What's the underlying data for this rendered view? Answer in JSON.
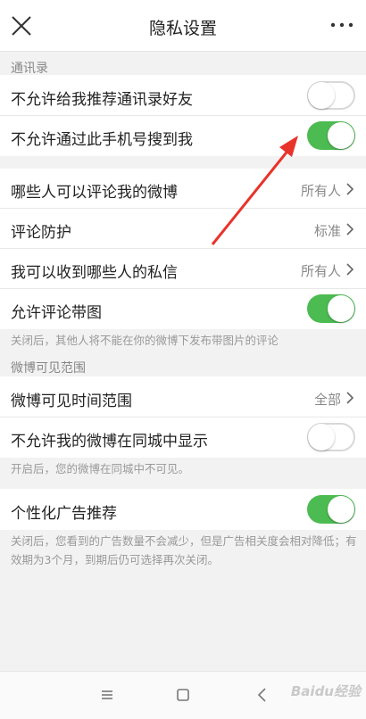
{
  "header": {
    "title": "隐私设置",
    "close_icon": "close-icon",
    "more_icon": "more-dots-icon"
  },
  "sections": {
    "contacts_title": "通讯录",
    "weibo_visible_title": "微博可见范围"
  },
  "rows": {
    "no_recommend_contacts": {
      "label": "不允许给我推荐通讯录好友",
      "toggle": "off"
    },
    "no_search_by_phone": {
      "label": "不允许通过此手机号搜到我",
      "toggle": "on"
    },
    "who_can_comment": {
      "label": "哪些人可以评论我的微博",
      "value": "所有人"
    },
    "comment_protection": {
      "label": "评论防护",
      "value": "标准"
    },
    "who_can_message": {
      "label": "我可以收到哪些人的私信",
      "value": "所有人"
    },
    "allow_comment_images": {
      "label": "允许评论带图",
      "toggle": "on"
    },
    "weibo_visible_time": {
      "label": "微博可见时间范围",
      "value": "全部"
    },
    "no_show_same_city": {
      "label": "不允许我的微博在同城中显示",
      "toggle": "off"
    },
    "personalized_ads": {
      "label": "个性化广告推荐",
      "toggle": "on"
    }
  },
  "notes": {
    "comment_images_note": "关闭后，其他人将不能在你的微博下发布带图片的评论",
    "same_city_note": "开启后，您的微博在同城中不可见。",
    "ads_note_line1": "关闭后，您看到的广告数量不会减少，但是广告相关度会相对降低；有",
    "ads_note_line2": "效期为3个月，到期后仍可选择再次关闭。"
  },
  "bottom_nav": {
    "menu_icon": "menu-icon",
    "home_icon": "home-square-icon",
    "back_icon": "back-chevron-icon"
  },
  "watermark": "Baidu经验",
  "colors": {
    "toggle_on": "#4cbb51",
    "annotation_arrow": "#e8332a"
  }
}
